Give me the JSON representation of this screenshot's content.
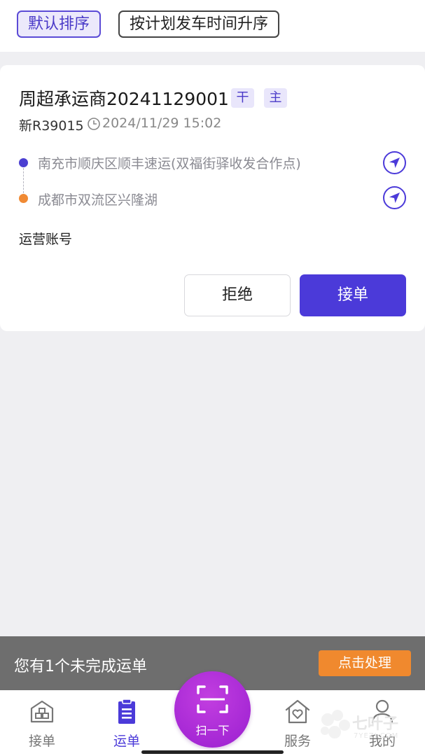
{
  "sort": {
    "default_label": "默认排序",
    "plan_label": "按计划发车时间升序",
    "active": "default"
  },
  "order": {
    "title": "周超承运商20241129001",
    "tags": [
      "干",
      "主"
    ],
    "plate": "新R39015",
    "time": "2024/11/29 15:02",
    "origin": "南充市顺庆区顺丰速运(双福街驿收发合作点)",
    "destination": "成都市双流区兴隆湖",
    "account_label": "运营账号",
    "reject_label": "拒绝",
    "accept_label": "接单"
  },
  "banner": {
    "text": "您有1个未完成运单",
    "button_label": "点击处理"
  },
  "tabs": [
    {
      "label": "接单",
      "icon": "warehouse-icon"
    },
    {
      "label": "运单",
      "icon": "clipboard-icon"
    },
    {
      "label": "服务",
      "icon": "home-heart-icon"
    },
    {
      "label": "我的",
      "icon": "person-icon"
    }
  ],
  "scan": {
    "label": "扫一下",
    "icon": "scan-icon"
  },
  "watermark": {
    "text": "七叶子",
    "sub": "7YEZI.COM"
  },
  "colors": {
    "accent": "#4b3ad9",
    "scan_purple": "#a52bd6",
    "origin_dot": "#4b3fd1",
    "destination_dot": "#f08a34",
    "banner_button": "#f0892e"
  }
}
